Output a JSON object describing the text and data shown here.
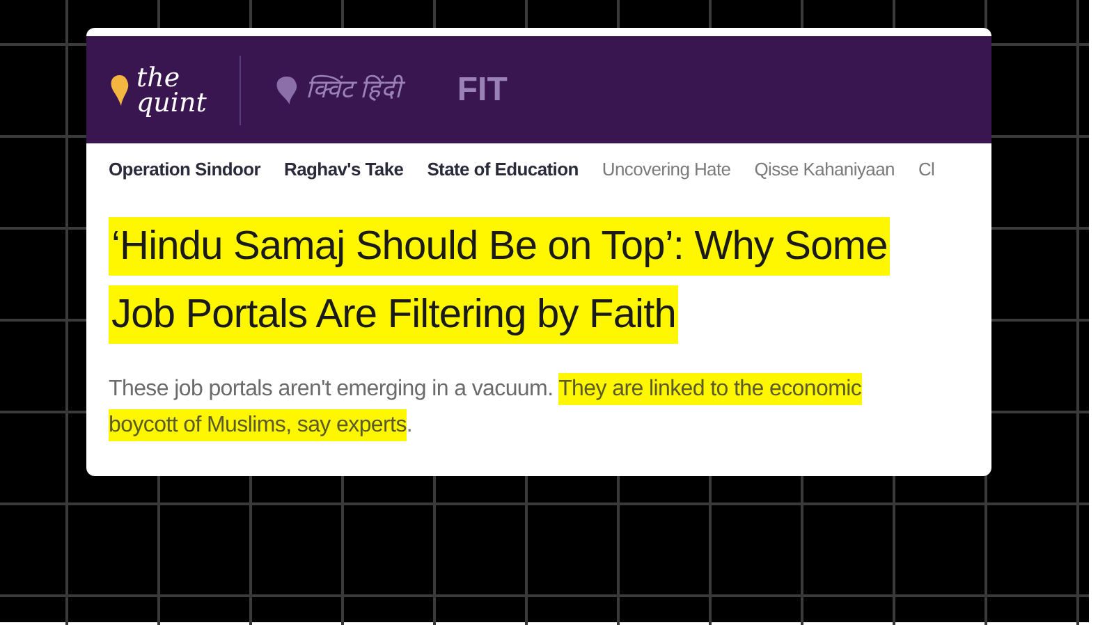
{
  "header": {
    "logos": [
      {
        "kind": "quint",
        "lines": [
          "the",
          "quint"
        ]
      },
      {
        "kind": "hindi",
        "lines": [
          "क्विंट हिंदी"
        ]
      },
      {
        "kind": "fit",
        "lines": [
          "FIT"
        ]
      }
    ]
  },
  "nav": {
    "items": [
      {
        "label": "Operation Sindoor",
        "muted": false
      },
      {
        "label": "Raghav's Take",
        "muted": false
      },
      {
        "label": "State of Education",
        "muted": false
      },
      {
        "label": "Uncovering Hate",
        "muted": true
      },
      {
        "label": "Qisse Kahaniyaan",
        "muted": true
      },
      {
        "label": "Cl",
        "muted": true
      }
    ]
  },
  "article": {
    "headline": "‘Hindu Samaj Should Be on Top’: Why Some Job Portals Are Filtering by Faith",
    "summary": [
      {
        "text": "These job portals aren't emerging in a vacuum. ",
        "highlighted": false
      },
      {
        "text": "They are linked to the economic boycott of Muslims, say experts",
        "highlighted": true
      },
      {
        "text": ".",
        "highlighted": false
      }
    ]
  }
}
